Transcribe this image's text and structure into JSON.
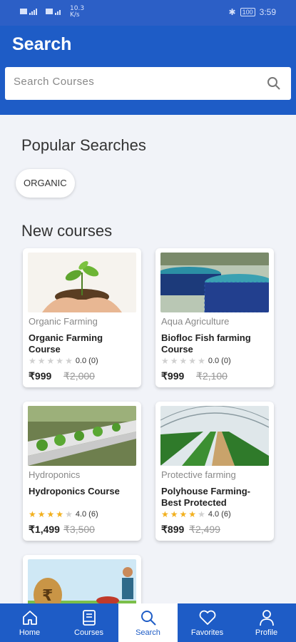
{
  "status_bar": {
    "left_signal": "4G",
    "speed": "10.3 K/s",
    "battery": "100",
    "time": "3:59"
  },
  "header": {
    "title": "Search",
    "search_placeholder": "Search Courses"
  },
  "popular": {
    "title": "Popular Searches",
    "chips": [
      "ORGANIC"
    ]
  },
  "new_courses": {
    "title": "New courses",
    "courses": [
      {
        "category": "Organic Farming",
        "name": "Organic Farming Course",
        "rating": "0.0 (0)",
        "stars": 0,
        "price": "₹999",
        "mrp": "₹2,000"
      },
      {
        "category": "Aqua Agriculture",
        "name": "Biofloc Fish farming Course",
        "rating": "0.0 (0)",
        "stars": 0,
        "price": "₹999",
        "mrp": "₹2,100"
      },
      {
        "category": "Hydroponics",
        "name": "Hydroponics Course",
        "rating": "4.0 (6)",
        "stars": 4,
        "price": "₹1,499",
        "mrp": "₹3,500"
      },
      {
        "category": "Protective farming",
        "name": "Polyhouse Farming-Best Protected",
        "rating": "4.0 (6)",
        "stars": 4,
        "price": "₹899",
        "mrp": "₹2,499"
      }
    ]
  },
  "nav": [
    {
      "label": "Home",
      "icon": "home-icon"
    },
    {
      "label": "Courses",
      "icon": "book-icon"
    },
    {
      "label": "Search",
      "icon": "search-icon"
    },
    {
      "label": "Favorites",
      "icon": "heart-icon"
    },
    {
      "label": "Profile",
      "icon": "person-icon"
    }
  ],
  "colors": {
    "primary": "#1e5cc6",
    "star": "#f2b01e",
    "star_empty": "#d0d0d0"
  }
}
